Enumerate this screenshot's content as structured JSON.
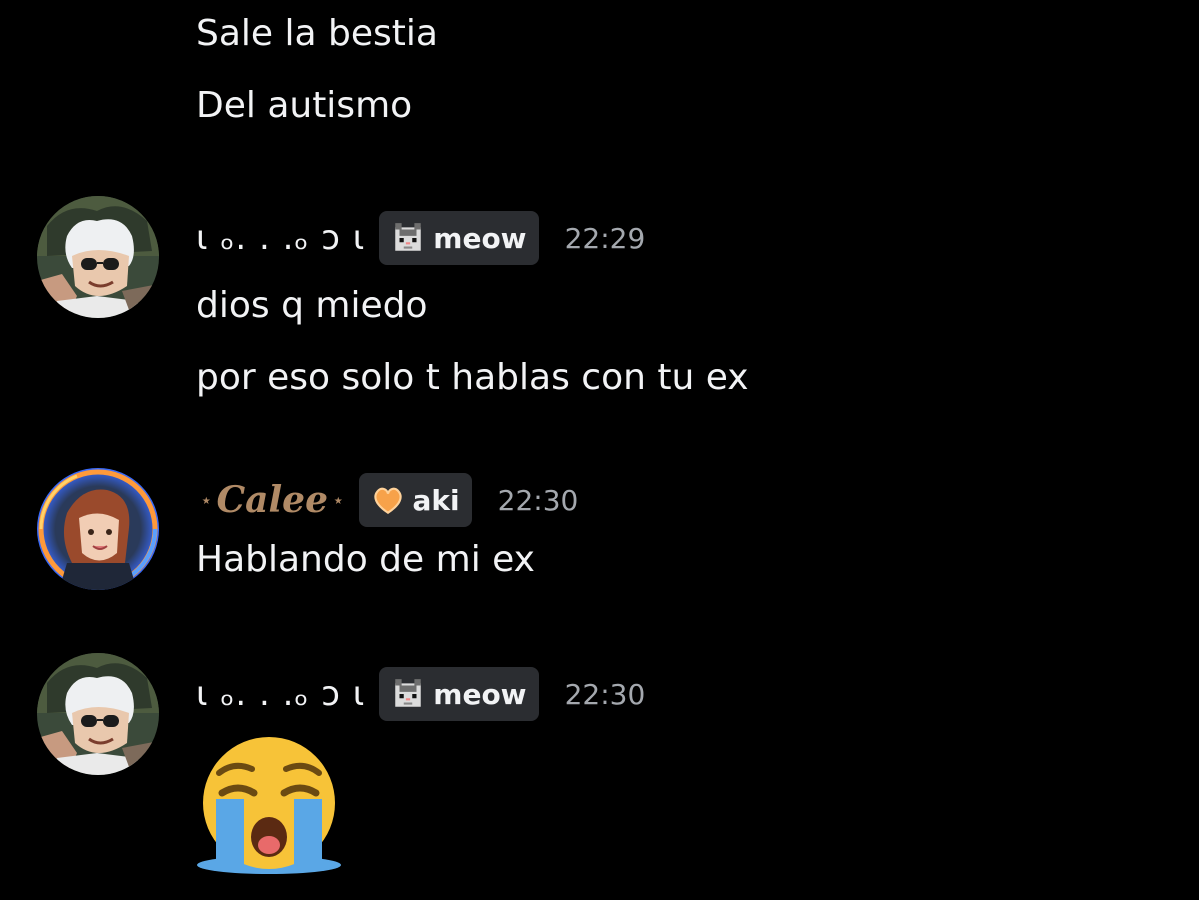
{
  "messages": [
    {
      "text": "Sale la bestia"
    },
    {
      "text": "Del autismo"
    }
  ],
  "group1": {
    "username": "ɩ ₒ. . .ₒ ɔ ɩ",
    "tag": {
      "icon": "pixel-cat-icon",
      "label": "meow"
    },
    "time": "22:29",
    "lines": [
      "dios q miedo",
      "por eso solo t hablas con tu ex"
    ]
  },
  "group2": {
    "username": "Calee",
    "star_left": "⋆",
    "star_right": "⋆",
    "tag": {
      "icon": "orange-heart-icon",
      "label": "aki"
    },
    "time": "22:30",
    "lines": [
      "Hablando de mi ex"
    ]
  },
  "group3": {
    "username": "ɩ ₒ. . .ₒ ɔ ɩ",
    "tag": {
      "icon": "pixel-cat-icon",
      "label": "meow"
    },
    "time": "22:30",
    "emoji": "loudly-crying-face-emoji"
  },
  "colors": {
    "background": "#000000",
    "text": "#f2f3f5",
    "timestamp": "#a4a8ae",
    "tag_bg": "#2b2d31",
    "calee_name": "#b08a66"
  }
}
